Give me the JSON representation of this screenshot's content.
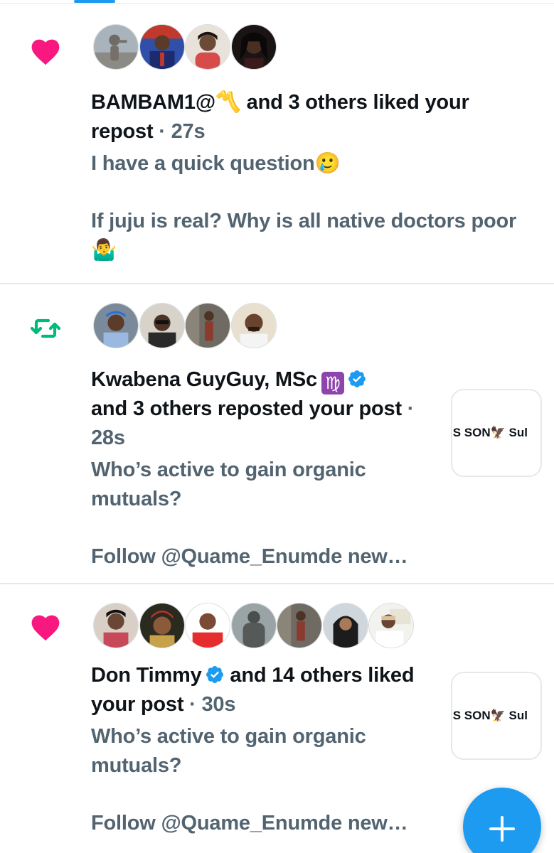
{
  "colors": {
    "like": "#f91880",
    "repost": "#00ba7c",
    "accent": "#1d9bf0",
    "muted": "#536471"
  },
  "notifications": [
    {
      "type": "like",
      "icon": "heart-icon",
      "actor": "BAMBAM1@〽️",
      "action": " and 3 others liked your repost",
      "time": " · 27s",
      "text_line1": "I have a quick question🥲",
      "text_line2": "If juju is real? Why is all native doctors poor 🤷‍♂️"
    },
    {
      "type": "repost",
      "icon": "repost-icon",
      "actor": "Kwabena GuyGuy, MSc",
      "action": "and 3 others reposted your post",
      "time": " · 28s",
      "text_line1": "Who’s active to gain organic mutuals?",
      "text_line2": "Follow @Quame_Enumde new…",
      "thumb_text": "’S SON🦅 Sul"
    },
    {
      "type": "like",
      "icon": "heart-icon",
      "actor": "Don Timmy",
      "action": " and 14 others liked your post",
      "time": " · 30s",
      "text_line1": "Who’s active to gain organic mutuals?",
      "text_line2": "Follow @Quame_Enumde new…",
      "thumb_text": "’S SON🦅 Sul"
    }
  ],
  "fab": {
    "icon": "plus-icon"
  }
}
